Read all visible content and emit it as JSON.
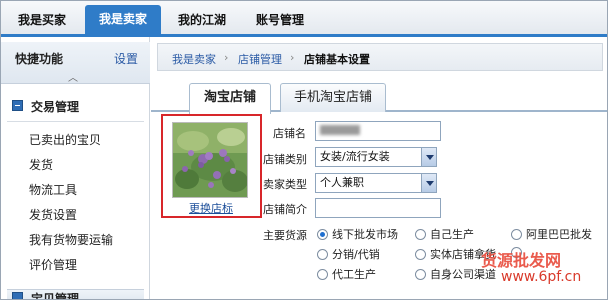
{
  "topnav": {
    "tabs": [
      {
        "label": "我是买家",
        "active": false
      },
      {
        "label": "我是卖家",
        "active": true
      },
      {
        "label": "我的江湖",
        "active": false
      },
      {
        "label": "账号管理",
        "active": false
      }
    ]
  },
  "sidebar": {
    "title": "快捷功能",
    "settings": "设置",
    "caret": "︿",
    "section": "交易管理",
    "items": [
      "已卖出的宝贝",
      "发货",
      "物流工具",
      "发货设置",
      "我有货物要运输",
      "评价管理"
    ],
    "next_section": "宝贝管理"
  },
  "breadcrumb": {
    "items": [
      "我是卖家",
      "店铺管理",
      "店铺基本设置"
    ],
    "separator": "›"
  },
  "tabs": [
    "淘宝店铺",
    "手机淘宝店铺"
  ],
  "logo": {
    "change_label": "更换店标"
  },
  "form": {
    "shop_name_label": "店铺名",
    "shop_name_value": "*衣里",
    "shop_category_label": "店铺类别",
    "shop_category_value": "女装/流行女装",
    "seller_type_label": "卖家类型",
    "seller_type_value": "个人兼职",
    "intro_label": "店铺简介",
    "intro_value": "",
    "source_label": "主要货源",
    "sources": [
      {
        "label": "线下批发市场",
        "checked": true
      },
      {
        "label": "自己生产",
        "checked": false
      },
      {
        "label": "阿里巴巴批发",
        "checked": false
      },
      {
        "label": "分销/代销",
        "checked": false
      },
      {
        "label": "实体店铺拿货",
        "checked": false
      },
      {
        "label": "",
        "checked": false
      },
      {
        "label": "代工生产",
        "checked": false
      },
      {
        "label": "自身公司渠道",
        "checked": false
      }
    ]
  },
  "watermark": {
    "text1": "货源批发网",
    "text2": "www.6pf.cn"
  },
  "colors": {
    "accent": "#2f7cc8",
    "highlight_box": "#d8262a",
    "watermark": "#e84a3a"
  }
}
